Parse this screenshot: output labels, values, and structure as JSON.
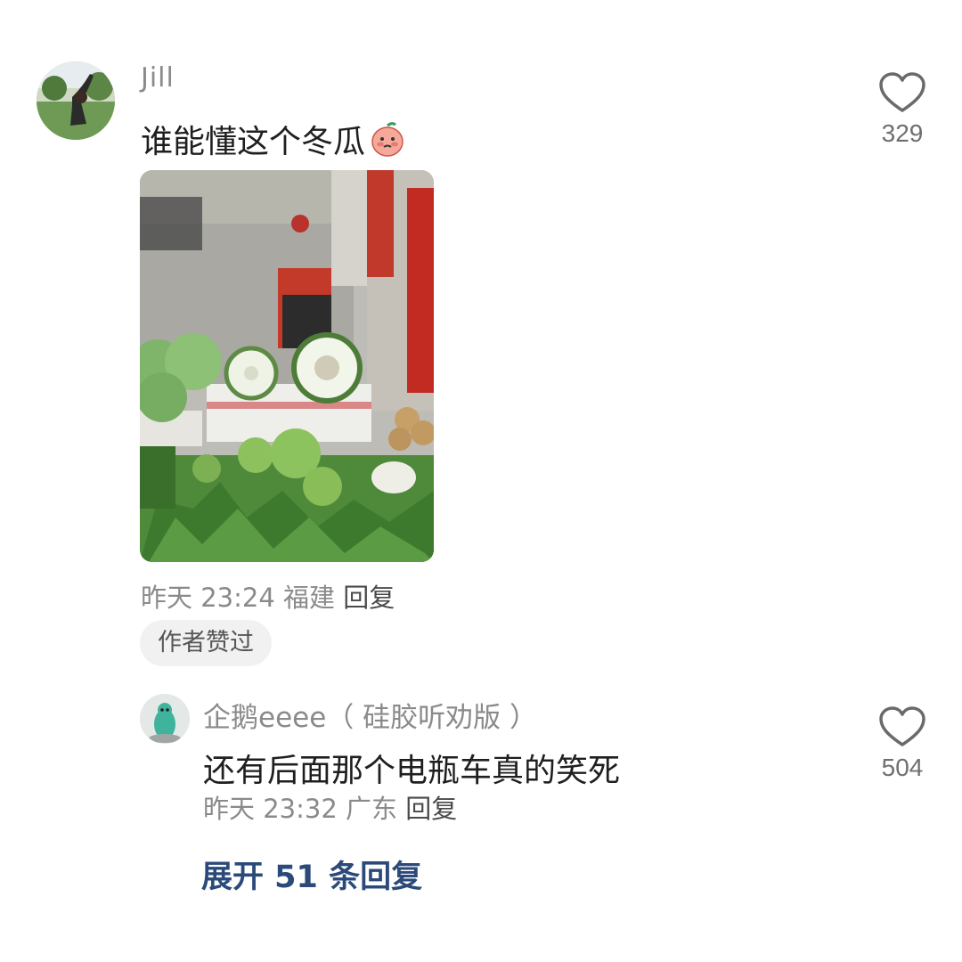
{
  "comments": [
    {
      "username": "Jill",
      "text": "谁能懂这个冬瓜",
      "emoji": "shy-peach-face-emoji",
      "time": "昨天 23:24",
      "location": "福建",
      "reply_label": "回复",
      "badge": "作者赞过",
      "likes": "329",
      "image": "market-winter-melon-photo"
    }
  ],
  "replies": [
    {
      "username": "企鹅eeee（ 硅胶听劝版 ）",
      "text": "还有后面那个电瓶车真的笑死",
      "time": "昨天 23:32",
      "location": "广东",
      "reply_label": "回复",
      "likes": "504"
    }
  ],
  "expand_label": "展开 51 条回复",
  "colors": {
    "username": "#8a8a8a",
    "body_text": "#1f1f1f",
    "expand_link": "#2b4a7a",
    "badge_bg": "#f1f1f1"
  }
}
